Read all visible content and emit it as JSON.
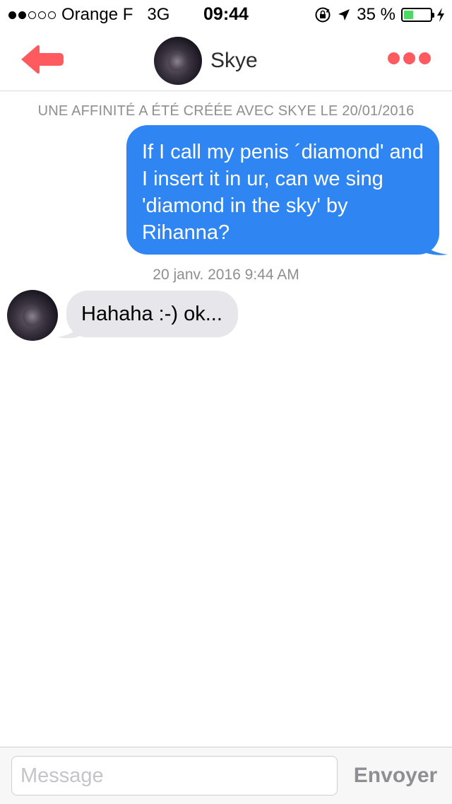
{
  "status_bar": {
    "signal_dots_filled": 2,
    "signal_dots_total": 5,
    "carrier": "Orange F",
    "network": "3G",
    "time": "09:44",
    "battery_percent": "35 %",
    "battery_level": 0.35,
    "battery_color": "#4cd964",
    "icons": [
      "rotation-lock-icon",
      "location-arrow-icon",
      "battery-icon",
      "charging-bolt-icon"
    ]
  },
  "nav": {
    "back_icon": "back-arrow-icon",
    "contact_name": "Skye",
    "more_icon": "more-dots-icon",
    "accent_color": "#ff5a5f"
  },
  "chat": {
    "match_info": "UNE AFFINITÉ A ÉTÉ CRÉÉE AVEC SKYE LE 20/01/2016",
    "messages": [
      {
        "direction": "outgoing",
        "text": "If I call my penis ´diamond' and I insert it in ur, can we sing 'diamond in the sky' by Rihanna?",
        "color": "#2f86f2"
      },
      {
        "direction": "incoming",
        "text": "Hahaha :-) ok...",
        "color": "#e6e6eb"
      }
    ],
    "timestamp": "20 janv. 2016 9:44 AM"
  },
  "composer": {
    "placeholder": "Message",
    "value": "",
    "send_label": "Envoyer"
  }
}
